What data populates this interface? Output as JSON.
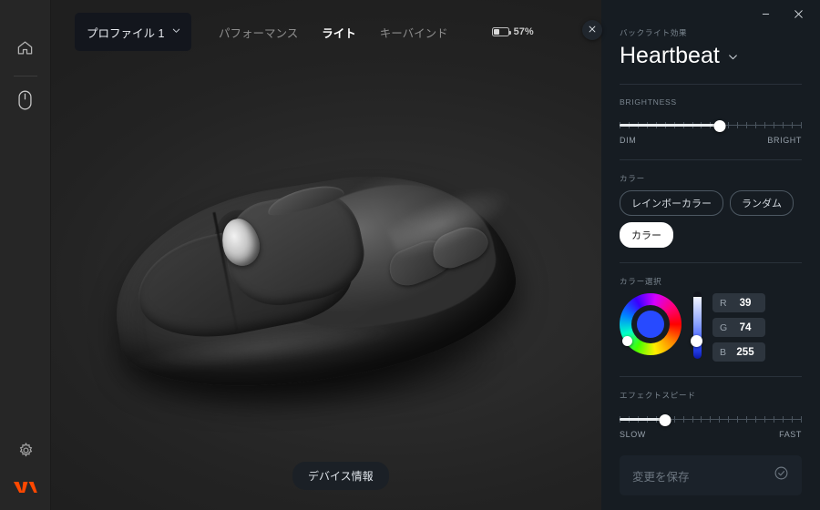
{
  "window": {
    "minimize_label": "–",
    "close_label": "✕"
  },
  "sidebar": {
    "items": [
      {
        "icon": "home-icon",
        "name": "home"
      },
      {
        "icon": "mouse-icon",
        "name": "mouse"
      }
    ],
    "bottom": [
      {
        "icon": "gear-icon",
        "name": "settings"
      },
      {
        "icon": "fnatic-logo",
        "name": "brand"
      }
    ]
  },
  "topbar": {
    "profile": {
      "label": "プロファイル 1",
      "chevron": "chevron-down-icon"
    },
    "nav": [
      {
        "label": "パフォーマンス",
        "active": false
      },
      {
        "label": "ライト",
        "active": true
      },
      {
        "label": "キーバインド",
        "active": false
      }
    ],
    "battery": {
      "percent_label": "57%",
      "level": 57
    }
  },
  "main": {
    "device_info_label": "デバイス情報",
    "device_image": "gaming-mouse-photo"
  },
  "panel": {
    "close_label": "✕",
    "effect": {
      "section_label": "バックライト効果",
      "name": "Heartbeat",
      "chevron": "chevron-down-icon"
    },
    "brightness": {
      "label": "BRIGHTNESS",
      "min_label": "DIM",
      "max_label": "BRIGHT",
      "value": 55,
      "ticks": 21
    },
    "color": {
      "label": "カラー",
      "options": [
        {
          "label": "レインボーカラー",
          "selected": false
        },
        {
          "label": "ランダム",
          "selected": false
        },
        {
          "label": "カラー",
          "selected": true
        }
      ]
    },
    "color_picker": {
      "label": "カラー選択",
      "swatch_hex": "#274aff",
      "wheel_handle_angle": 205,
      "value_slider_position": 88,
      "channels": [
        {
          "key": "R",
          "value": "39"
        },
        {
          "key": "G",
          "value": "74"
        },
        {
          "key": "B",
          "value": "255"
        }
      ]
    },
    "speed": {
      "label": "エフェクトスピード",
      "min_label": "SLOW",
      "max_label": "FAST",
      "value": 25,
      "ticks": 21
    },
    "save": {
      "label": "変更を保存",
      "icon": "check-circle-icon",
      "enabled": false
    }
  },
  "colors": {
    "app_bg": "#242424",
    "panel_bg": "#161c22",
    "rail_bg": "#262626",
    "accent": "#ff4800",
    "selected_color": "#274aff"
  }
}
